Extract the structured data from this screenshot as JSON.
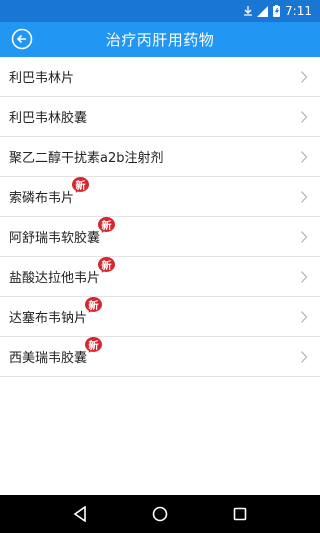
{
  "status_bar": {
    "time": "7:11",
    "icons": [
      "download-icon",
      "signal-icon",
      "battery-charging-icon"
    ]
  },
  "app_bar": {
    "title": "治疗丙肝用药物",
    "back_icon": "back-arrow-icon"
  },
  "drugs": [
    {
      "label": "利巴韦林片",
      "is_new": false
    },
    {
      "label": "利巴韦林胶囊",
      "is_new": false
    },
    {
      "label": "聚乙二醇干扰素a2b注射剂",
      "is_new": false
    },
    {
      "label": "索磷布韦片",
      "is_new": true
    },
    {
      "label": "阿舒瑞韦软胶囊",
      "is_new": true
    },
    {
      "label": "盐酸达拉他韦片",
      "is_new": true
    },
    {
      "label": "达塞布韦钠片",
      "is_new": true
    },
    {
      "label": "西美瑞韦胶囊",
      "is_new": true
    }
  ],
  "new_badge_text": "新",
  "nav_bar": {
    "buttons": [
      "back-triangle-icon",
      "home-circle-icon",
      "recents-square-icon"
    ]
  },
  "colors": {
    "status_bar": "#1976d2",
    "app_bar": "#2196f3",
    "badge": "#d7262e"
  }
}
